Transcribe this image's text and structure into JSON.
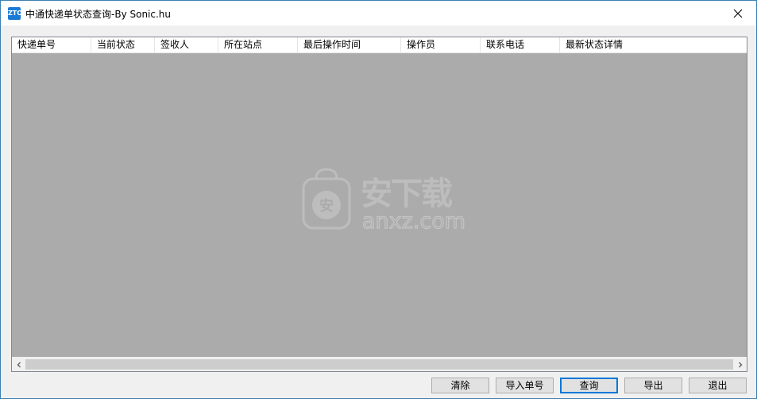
{
  "window": {
    "title": "中通快递单状态查询-By Sonic.hu",
    "icon_label": "ZTO",
    "icon": "zto-app-icon",
    "close_icon": "close-icon"
  },
  "table": {
    "columns": [
      "快递单号",
      "当前状态",
      "签收人",
      "所在站点",
      "最后操作时间",
      "操作员",
      "联系电话",
      "最新状态详情"
    ],
    "rows": []
  },
  "watermark": {
    "badge_char": "安",
    "text": "安下载",
    "domain": "anxz.com"
  },
  "buttons": {
    "clear": "清除",
    "import": "导入单号",
    "query": "查询",
    "export": "导出",
    "exit": "退出"
  },
  "colors": {
    "accent": "#0078d7",
    "list_background": "#ababab",
    "window_border": "#3c7fb1"
  }
}
